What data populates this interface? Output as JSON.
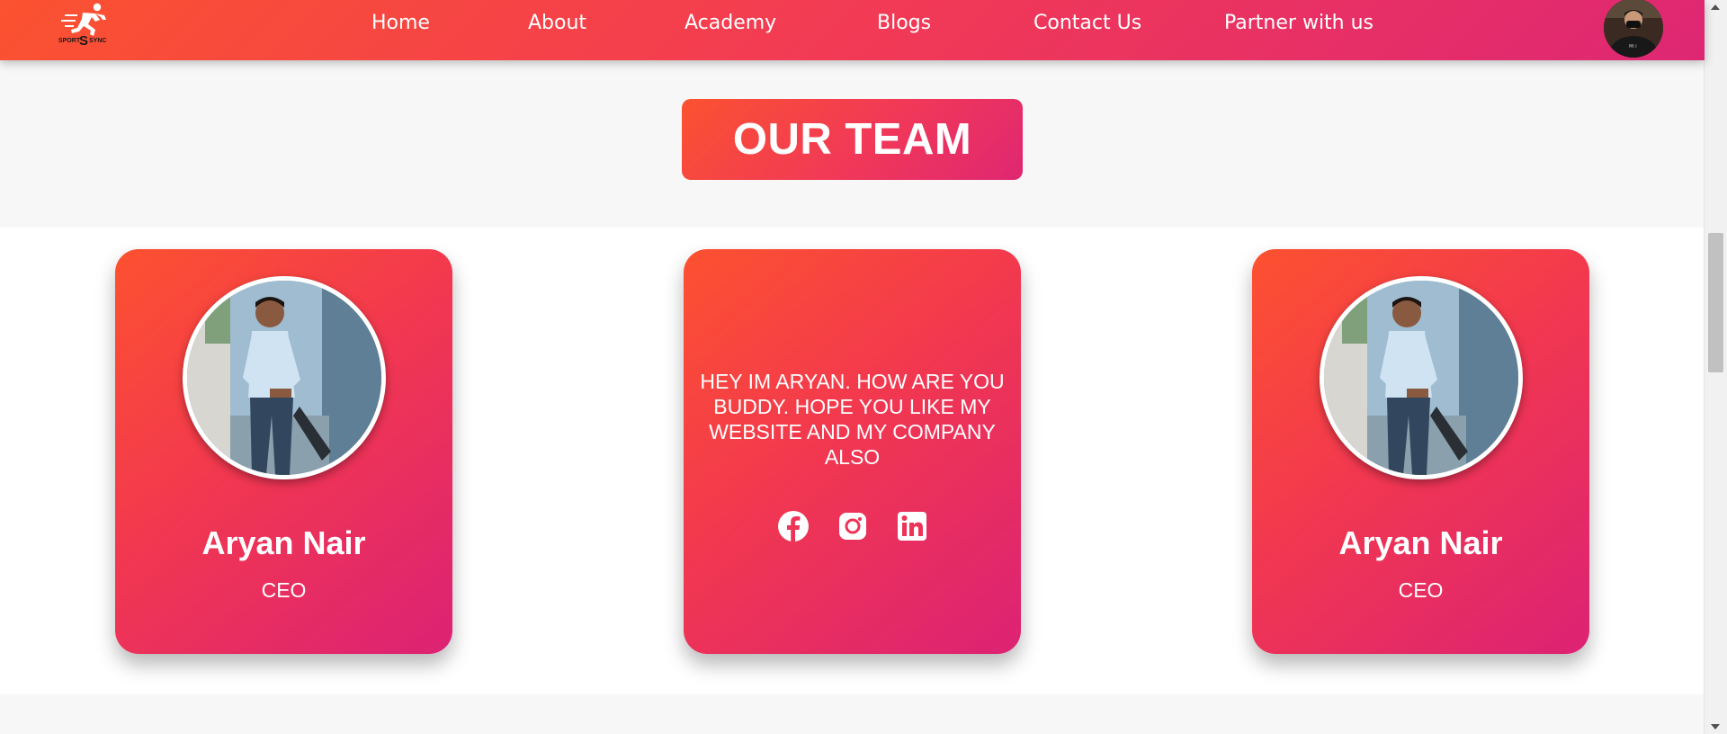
{
  "nav": {
    "logo_text": "SPORTSSYNC",
    "links": [
      {
        "label": "Home"
      },
      {
        "label": "About"
      },
      {
        "label": "Academy"
      },
      {
        "label": "Blogs"
      },
      {
        "label": "Contact Us"
      },
      {
        "label": "Partner with us"
      }
    ],
    "profile_icon": "user-avatar"
  },
  "section": {
    "title": "OUR TEAM"
  },
  "cards": [
    {
      "name": "Aryan Nair",
      "role": "CEO",
      "photo": "team-member-photo"
    },
    {
      "message": "HEY IM ARYAN. HOW ARE YOU BUDDY. HOPE YOU LIKE MY WEBSITE AND MY COMPANY ALSO",
      "socials": [
        "facebook-icon",
        "instagram-icon",
        "linkedin-icon"
      ]
    },
    {
      "name": "Aryan Nair",
      "role": "CEO",
      "photo": "team-member-photo"
    }
  ],
  "colors": {
    "gradient_start": "#fb5230",
    "gradient_mid": "#f23a55",
    "gradient_end": "#de2773",
    "text": "#ffffff",
    "page_bg": "#f7f7f7",
    "section_bg": "#ffffff"
  }
}
